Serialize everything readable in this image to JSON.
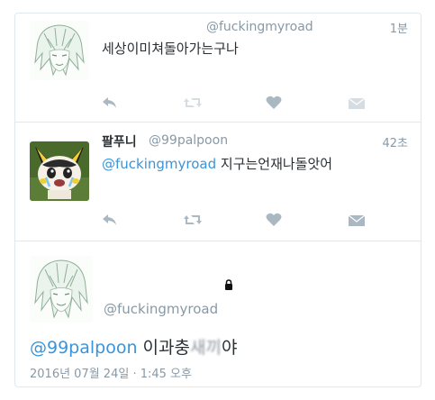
{
  "tweets": [
    {
      "handle": "@fuckingmyroad",
      "time": "1분",
      "text": "세상이미쳐돌아가는구나"
    },
    {
      "name": "팔푸니",
      "handle": "@99palpoon",
      "time": "42초",
      "mention": "@fuckingmyroad",
      "text": " 지구는언재나돌앗어"
    }
  ],
  "detail": {
    "handle": "@fuckingmyroad",
    "mention": "@99palpoon",
    "text_before": " 이과충",
    "text_blurred": "새끼",
    "text_after": "야",
    "datetime": "2016년 07월 24일 · 1:45 오후"
  },
  "colors": {
    "link": "#3b94d9",
    "secondary_text": "#8899a6",
    "icon": "#aab8c2",
    "border": "#e1e8ed"
  }
}
